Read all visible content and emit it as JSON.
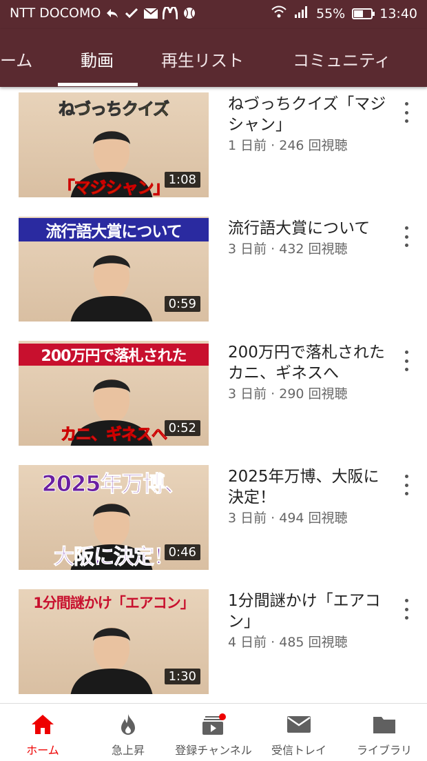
{
  "status_bar": {
    "carrier": "NTT DOCOMO",
    "battery_percent": "55%",
    "battery_level": 0.55,
    "time": "13:40"
  },
  "tabs": [
    {
      "label": "ーム"
    },
    {
      "label": "動画",
      "active": true
    },
    {
      "label": "再生リスト"
    },
    {
      "label": "コミュニティ"
    }
  ],
  "videos": [
    {
      "caption_top": "ねづっちクイズ",
      "caption_bottom": "「マジシャン」",
      "duration": "1:08",
      "title": "ねづっちクイズ「マジシャン」",
      "meta": "1 日前 · 246 回視聴"
    },
    {
      "caption_top": "流行語大賞について",
      "caption_bottom": "",
      "duration": "0:59",
      "title": "流行語大賞について",
      "meta": "3 日前 · 432 回視聴"
    },
    {
      "caption_top": "200万円で落札された",
      "caption_bottom": "カニ、ギネスへ",
      "duration": "0:52",
      "title": "200万円で落札されたカニ、ギネスへ",
      "meta": "3 日前 · 290 回視聴"
    },
    {
      "caption_top": "2025年万博、",
      "caption_bottom": "大阪に決定！",
      "duration": "0:46",
      "title": "2025年万博、大阪に決定！",
      "meta": "3 日前 · 494 回視聴"
    },
    {
      "caption_top": "1分間謎かけ「エアコン」",
      "caption_bottom": "",
      "duration": "1:30",
      "title": "1分間謎かけ「エアコン」",
      "meta": "4 日前 · 485 回視聴"
    }
  ],
  "bottom_nav": [
    {
      "label": "ホーム",
      "icon": "home-icon",
      "active": true
    },
    {
      "label": "急上昇",
      "icon": "flame-icon"
    },
    {
      "label": "登録チャンネル",
      "icon": "subscriptions-icon",
      "badge": true
    },
    {
      "label": "受信トレイ",
      "icon": "mail-icon"
    },
    {
      "label": "ライブラリ",
      "icon": "folder-icon"
    }
  ],
  "colors": {
    "header": "#5a2a30",
    "accent": "#e00000"
  }
}
